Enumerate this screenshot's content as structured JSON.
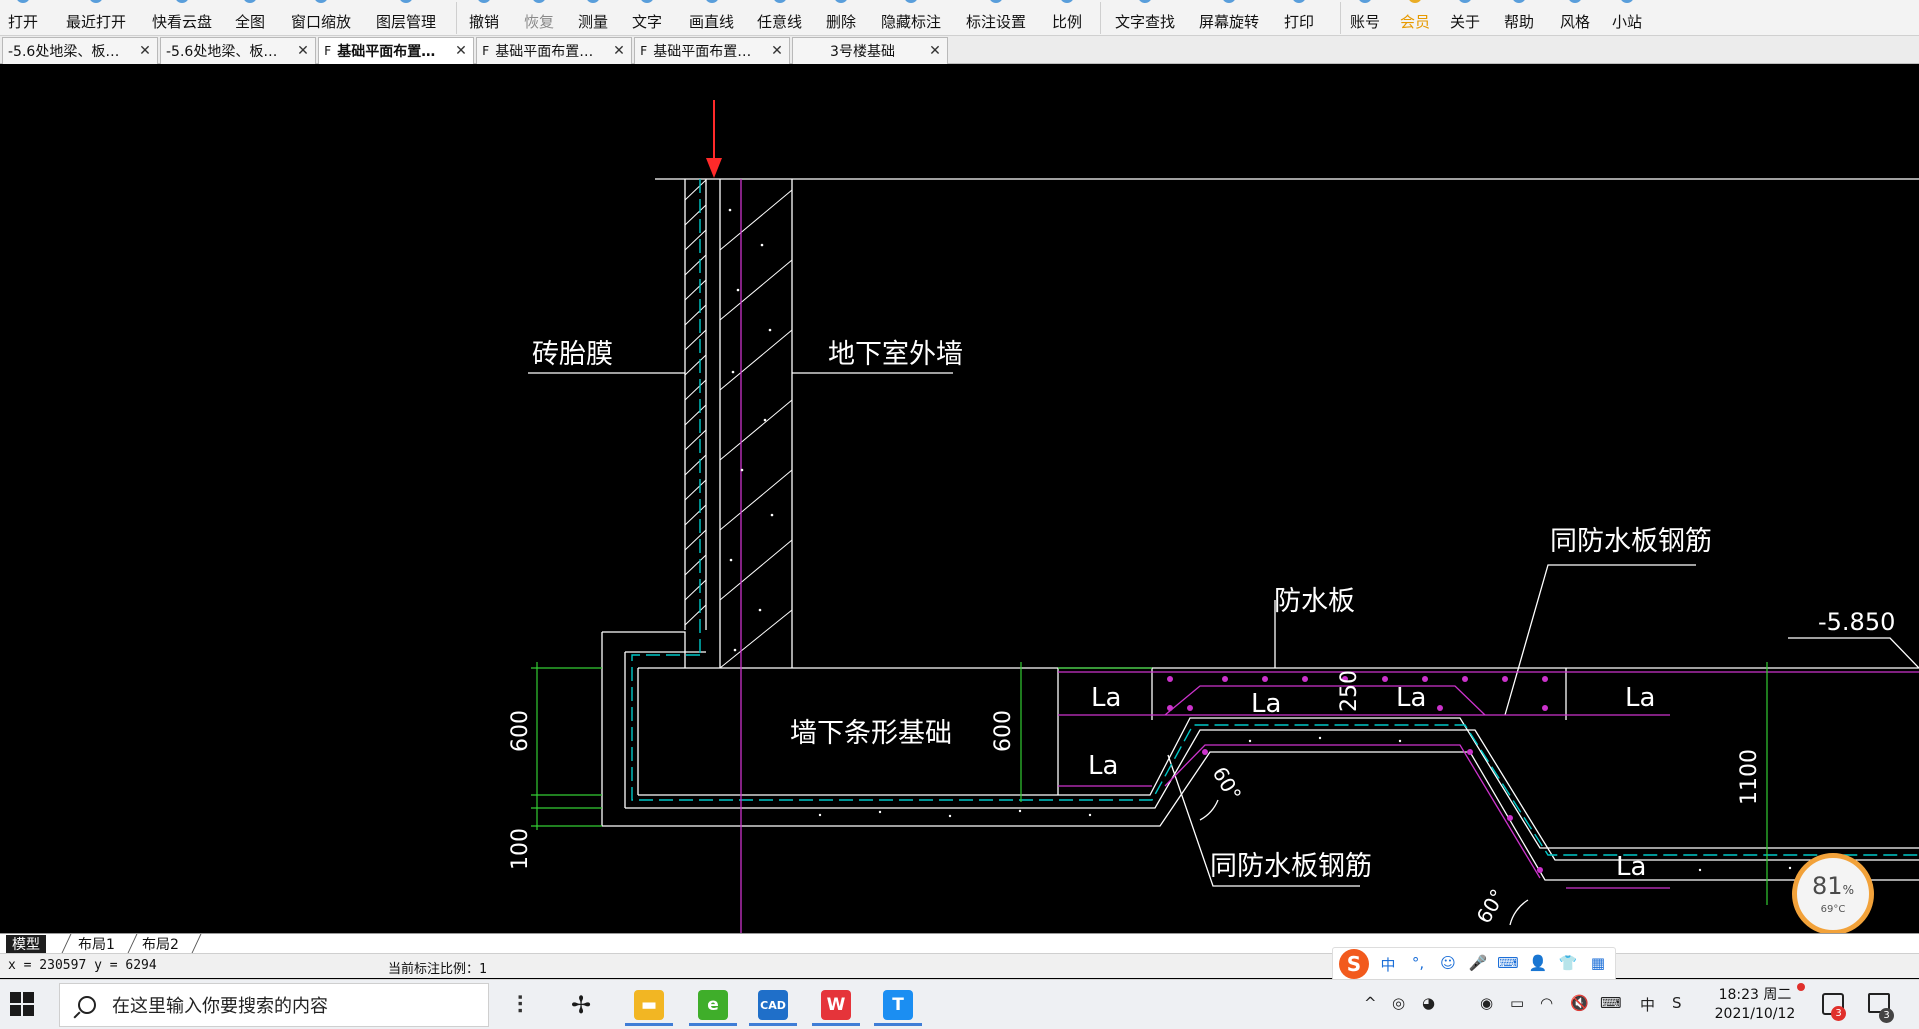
{
  "toolbar": {
    "buttons": [
      {
        "label": "打开",
        "state": "normal"
      },
      {
        "label": "最近打开",
        "state": "normal"
      },
      {
        "label": "快看云盘",
        "state": "normal"
      },
      {
        "label": "全图",
        "state": "normal"
      },
      {
        "label": "窗口缩放",
        "state": "normal"
      },
      {
        "label": "图层管理",
        "state": "normal"
      },
      {
        "label": "撤销",
        "state": "normal"
      },
      {
        "label": "恢复",
        "state": "disabled"
      },
      {
        "label": "测量",
        "state": "normal"
      },
      {
        "label": "文字",
        "state": "normal"
      },
      {
        "label": "画直线",
        "state": "normal"
      },
      {
        "label": "任意线",
        "state": "normal"
      },
      {
        "label": "删除",
        "state": "normal"
      },
      {
        "label": "隐藏标注",
        "state": "normal"
      },
      {
        "label": "标注设置",
        "state": "normal"
      },
      {
        "label": "比例",
        "state": "normal"
      },
      {
        "label": "文字查找",
        "state": "normal"
      },
      {
        "label": "屏幕旋转",
        "state": "normal"
      },
      {
        "label": "打印",
        "state": "normal"
      },
      {
        "label": "账号",
        "state": "normal"
      },
      {
        "label": "会员",
        "state": "vip"
      },
      {
        "label": "关于",
        "state": "normal"
      },
      {
        "label": "帮助",
        "state": "normal"
      },
      {
        "label": "风格",
        "state": "normal"
      },
      {
        "label": "小站",
        "state": "normal"
      }
    ]
  },
  "tabs": [
    {
      "flag": "",
      "label": "-5.6处地梁、板…",
      "active": false
    },
    {
      "flag": "",
      "label": "-5.6处地梁、板…",
      "active": false
    },
    {
      "flag": "F",
      "label": "基础平面布置…",
      "active": true
    },
    {
      "flag": "F",
      "label": "基础平面布置…",
      "active": false
    },
    {
      "flag": "F",
      "label": "基础平面布置…",
      "active": false
    },
    {
      "flag": "",
      "label": "3号楼基础",
      "active": false
    }
  ],
  "drawing": {
    "labels": {
      "brick_membrane": "砖胎膜",
      "outer_wall": "地下室外墙",
      "strip_footing": "墙下条形基础",
      "waterproof_slab": "防水板",
      "same_rebar_top": "同防水板钢筋",
      "same_rebar_bottom": "同防水板钢筋",
      "elevation": "-5.850",
      "la1": "La",
      "la2": "La",
      "la3": "La",
      "la4": "La",
      "la5": "La",
      "la6": "La",
      "dim_600_left": "600",
      "dim_100": "100",
      "dim_600_mid": "600",
      "dim_250": "250",
      "dim_1100": "1100",
      "angle_60_a": "60°",
      "angle_60_b": "60°"
    },
    "colors": {
      "line": "#ffffff",
      "dimension": "#33cc33",
      "rebar": "#cc33cc",
      "waterproof": "#00c8c8",
      "arrow": "#ff2a2a"
    }
  },
  "perf_gauge": {
    "value": "81",
    "unit": "%",
    "temp": "69°C"
  },
  "layout_tabs": [
    {
      "label": "模型",
      "active": true
    },
    {
      "label": "布局1",
      "active": false
    },
    {
      "label": "布局2",
      "active": false
    }
  ],
  "status": {
    "coords": "x = 230597  y = 6294",
    "scale": "当前标注比例：1"
  },
  "ime": {
    "logo": "S",
    "items": [
      "中",
      "°,",
      "☺",
      "🎤",
      "⌨",
      "👤",
      "👕",
      "▦"
    ]
  },
  "taskbar": {
    "search_placeholder": "在这里输入你要搜索的内容",
    "apps": [
      {
        "name": "task-view",
        "glyph": "⫶",
        "color": "#333333",
        "open": false
      },
      {
        "name": "fan-app",
        "glyph": "✢",
        "color": "#1a1a1a",
        "open": false
      },
      {
        "name": "file-explorer",
        "glyph": "▬",
        "color": "#f2b623",
        "open": true
      },
      {
        "name": "browser",
        "glyph": "e",
        "color": "#3fae2a",
        "open": true
      },
      {
        "name": "cad-viewer",
        "glyph": "CAD",
        "color": "#1f6fc9",
        "open": true
      },
      {
        "name": "wps",
        "glyph": "W",
        "color": "#e5343a",
        "open": true
      },
      {
        "name": "text-app",
        "glyph": "T",
        "color": "#1b8ef2",
        "open": true
      }
    ],
    "tray": [
      "^",
      "◎",
      "◕",
      "◉",
      "▭",
      "◠",
      "🔇",
      "⌨",
      "中",
      "S"
    ],
    "time": "18:23 周二",
    "date": "2021/10/12",
    "notification_badge": "3",
    "action_badge": "3"
  }
}
